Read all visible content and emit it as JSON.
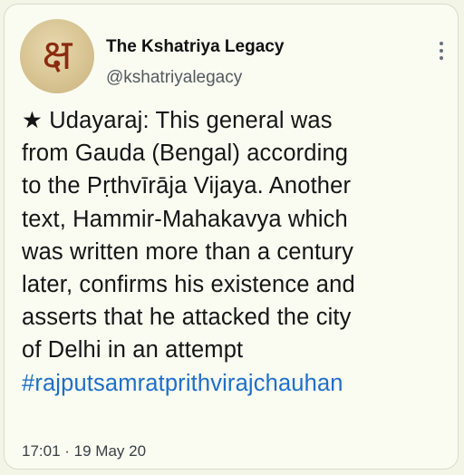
{
  "account": {
    "avatar_text": "क्ष",
    "display_name": "The Kshatriya Legacy",
    "handle": "@kshatriyalegacy"
  },
  "menu": {
    "icon": "more-dots-vertical-icon"
  },
  "tweet": {
    "lines": [
      "★ Udayaraj: This general was",
      "from Gauda (Bengal) according",
      "to the Pṛthvīrāja Vijaya. Another",
      "text, Hammir-Mahakavya which",
      "was written more than a century",
      "later, confirms his existence and",
      "asserts that he attacked the city",
      "of Delhi in an attempt"
    ],
    "hashtag": "#rajputsamratprithvirajchauhan"
  },
  "meta": {
    "timestamp": "17:01 · 19 May 20"
  },
  "colors": {
    "background": "#f3f6e6",
    "text": "#151515",
    "handle": "#54595f",
    "link": "#1d6ec9"
  }
}
